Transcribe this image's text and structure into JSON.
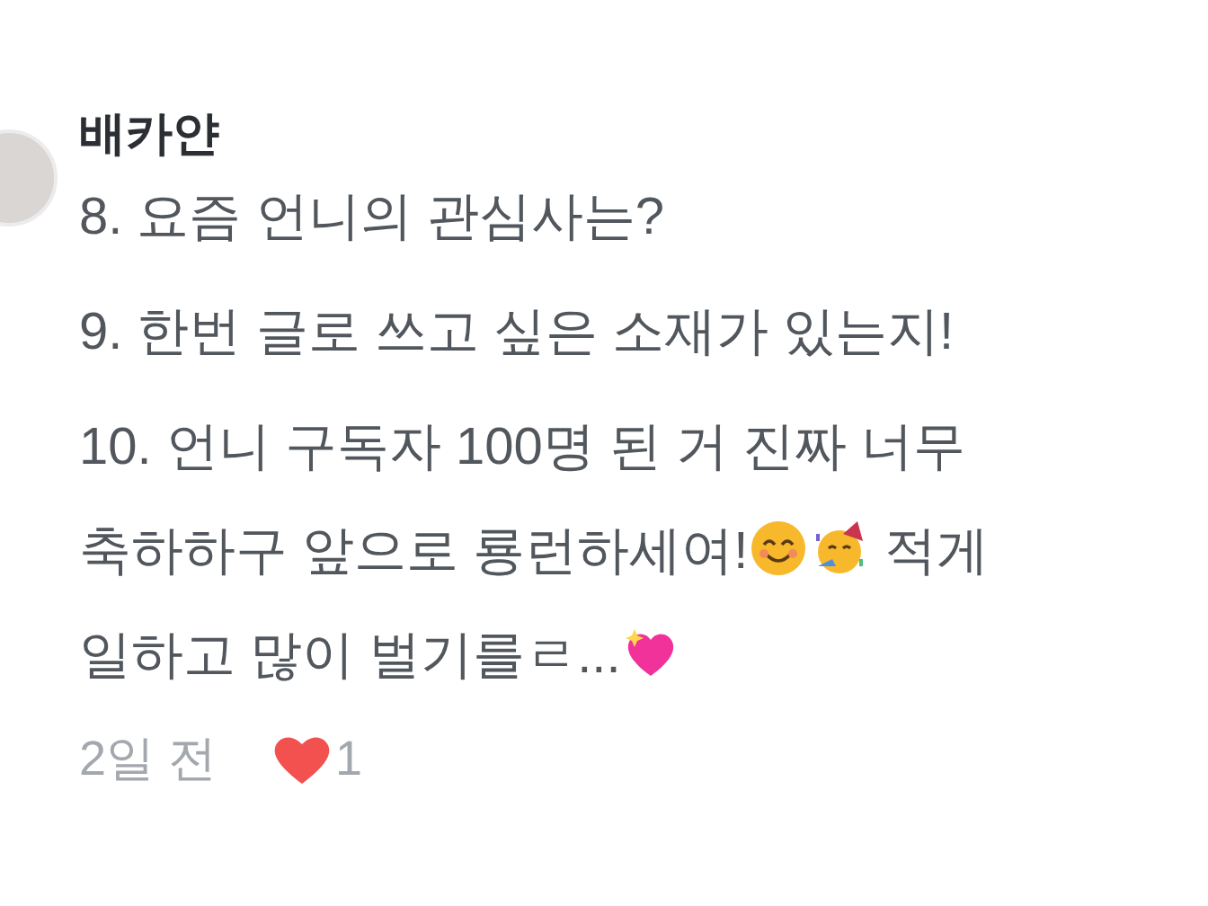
{
  "comment": {
    "author": "배카얀",
    "paragraphs": [
      {
        "parts": [
          {
            "kind": "text",
            "text": "8. 요즘 언니의 관심사는?"
          }
        ]
      },
      {
        "parts": [
          {
            "kind": "text",
            "text": "9. 한번 글로 쓰고 싶은 소재가 있는지!"
          }
        ]
      },
      {
        "parts": [
          {
            "kind": "text",
            "text": "10. 언니 구독자 100명 된 거 진짜 너무 축하하구 앞으로 룡런하세여!"
          },
          {
            "kind": "smile"
          },
          {
            "kind": "party"
          },
          {
            "kind": "text",
            "text": " 적게 일하고 많이 벌기를ㄹ..."
          },
          {
            "kind": "heart"
          }
        ]
      }
    ],
    "time": "2일 전",
    "likes": "1",
    "liked": true
  }
}
